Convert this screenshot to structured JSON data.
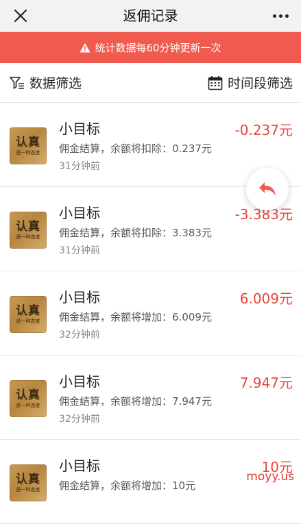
{
  "header": {
    "title": "返佣记录"
  },
  "notice": {
    "text": "统计数据每60分钟更新一次"
  },
  "filters": {
    "data_filter_label": "数据筛选",
    "time_filter_label": "时间段筛选"
  },
  "records": [
    {
      "avatar_big": "认真",
      "avatar_small": "是一种态度",
      "title": "小目标",
      "desc": "佣金结算，余额将扣除：0.237元",
      "time": "31分钟前",
      "amount": "-0.237元"
    },
    {
      "avatar_big": "认真",
      "avatar_small": "是一种态度",
      "title": "小目标",
      "desc": "佣金结算，余额将扣除：3.383元",
      "time": "31分钟前",
      "amount": "-3.383元"
    },
    {
      "avatar_big": "认真",
      "avatar_small": "是一种态度",
      "title": "小目标",
      "desc": "佣金结算，余额将增加：6.009元",
      "time": "32分钟前",
      "amount": "6.009元"
    },
    {
      "avatar_big": "认真",
      "avatar_small": "是一种态度",
      "title": "小目标",
      "desc": "佣金结算，余额将增加：7.947元",
      "time": "32分钟前",
      "amount": "7.947元"
    },
    {
      "avatar_big": "认真",
      "avatar_small": "是一种态度",
      "title": "小目标",
      "desc": "佣金结算，余额将增加：10元",
      "time": "",
      "amount": "10元"
    }
  ],
  "icons": {
    "close": "close-icon",
    "more": "more-icon",
    "warning": "warning-icon",
    "filter": "filter-icon",
    "calendar": "calendar-icon",
    "back": "back-arrow-icon"
  },
  "colors": {
    "notice_bg": "#f15a4e",
    "amount": "#e8463a",
    "topbar_bg": "#f2f2f2"
  },
  "watermark": "moyy.us"
}
